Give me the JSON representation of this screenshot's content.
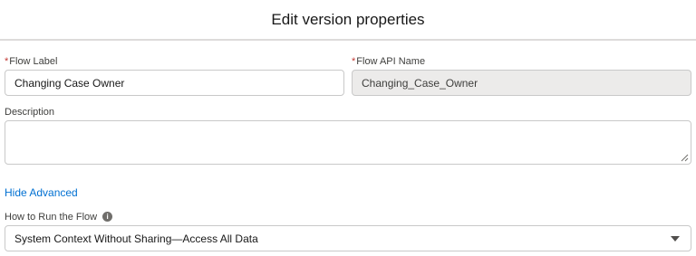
{
  "header": {
    "title": "Edit version properties"
  },
  "fields": {
    "flow_label": {
      "required_mark": "*",
      "label": "Flow Label",
      "value": "Changing Case Owner"
    },
    "flow_api_name": {
      "required_mark": "*",
      "label": "Flow API Name",
      "value": "Changing_Case_Owner"
    },
    "description": {
      "label": "Description",
      "value": ""
    }
  },
  "advanced": {
    "toggle_label": "Hide Advanced"
  },
  "run_mode": {
    "label": "How to Run the Flow",
    "info_icon": "info-icon",
    "info_glyph": "i",
    "selected": "System Context Without Sharing—Access All Data"
  },
  "colors": {
    "link": "#0070d2",
    "required": "#c23934",
    "readonly_bg": "#ecebea",
    "border": "#c9c9c9"
  }
}
